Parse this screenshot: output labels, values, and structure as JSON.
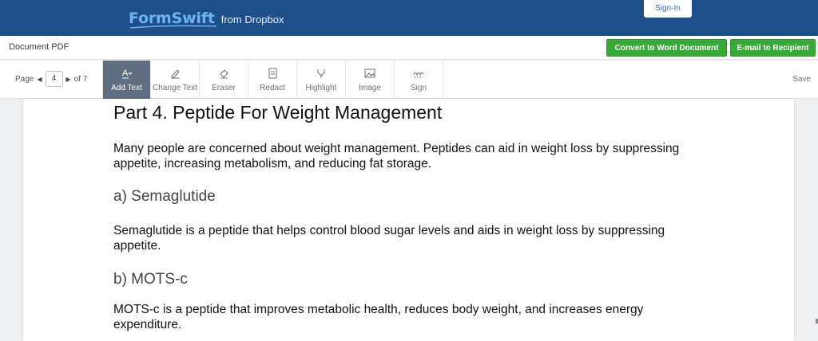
{
  "header": {
    "logo_text": "FormSwift",
    "logo_sub": "from Dropbox",
    "signin_label": "Sign-In",
    "brand_color": "#1e4f8a"
  },
  "titlebar": {
    "doc_title": "Document PDF",
    "convert_label": "Convert to Word Document",
    "email_label": "E-mail to Recipient",
    "button_color": "#38a838"
  },
  "toolbar": {
    "page_label": "Page",
    "page_current": "4",
    "page_total": "of 7",
    "tools": [
      {
        "label": "Add Text",
        "icon": "add-text-icon",
        "active": true
      },
      {
        "label": "Change Text",
        "icon": "pen-icon",
        "active": false
      },
      {
        "label": "Eraser",
        "icon": "eraser-icon",
        "active": false
      },
      {
        "label": "Redact",
        "icon": "redact-icon",
        "active": false
      },
      {
        "label": "Highlight",
        "icon": "highlight-icon",
        "active": false
      },
      {
        "label": "Image",
        "icon": "image-icon",
        "active": false
      },
      {
        "label": "Sign",
        "icon": "sign-icon",
        "active": false
      }
    ],
    "save_label": "Save"
  },
  "document": {
    "heading": "Part 4. Peptide For Weight Management",
    "intro": "Many people are concerned about weight management. Peptides can aid in weight loss by suppressing appetite, increasing metabolism, and reducing fat storage.",
    "section_a_title": "a) Semaglutide",
    "section_a_text": "Semaglutide is a peptide that helps control blood sugar levels and aids in weight loss by suppressing appetite.",
    "section_b_title": "b) MOTS-c",
    "section_b_text": "MOTS-c is a peptide that improves metabolic health, reduces body weight, and increases energy expenditure."
  }
}
